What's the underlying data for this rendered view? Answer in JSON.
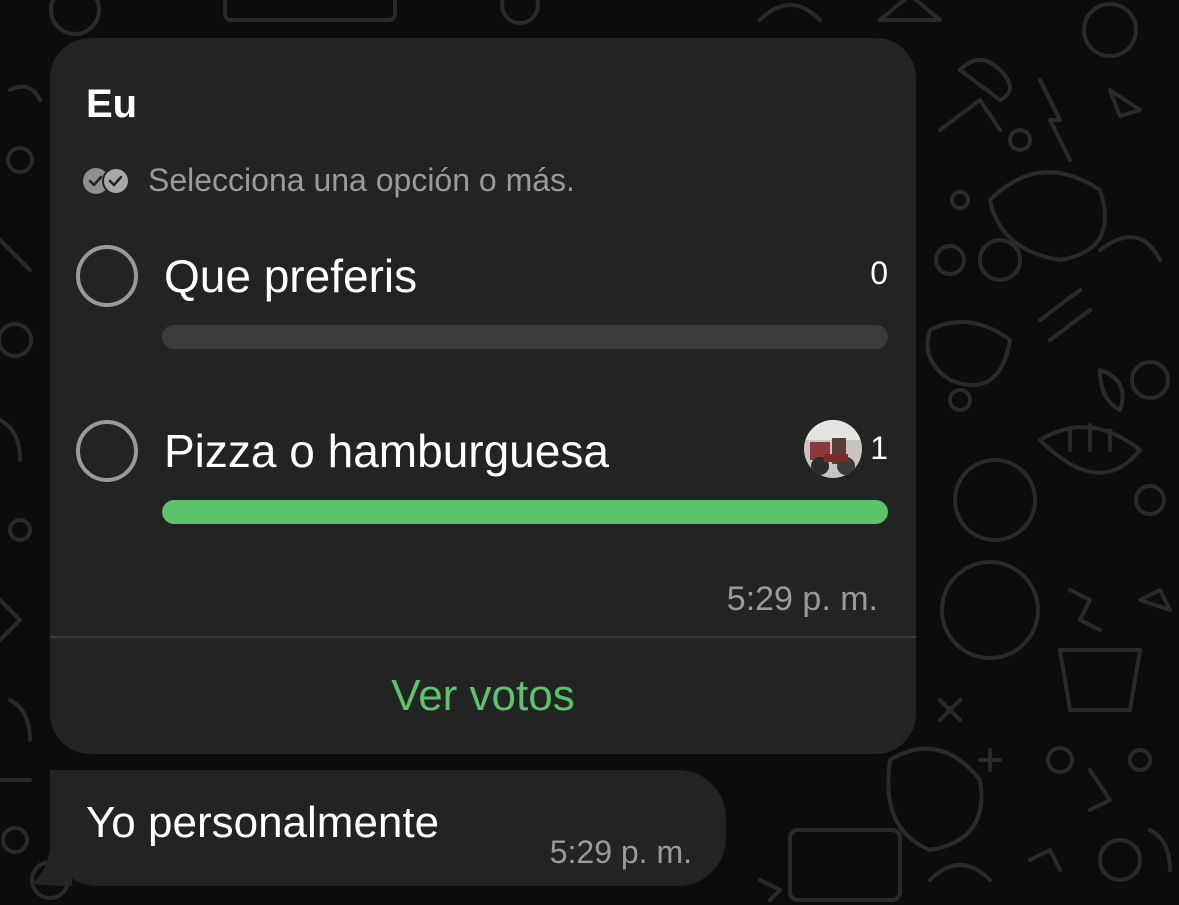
{
  "poll": {
    "sender": "Eu",
    "hint": "Selecciona una opción o más.",
    "options": [
      {
        "label": "Que preferis",
        "votes": "0",
        "fill_fraction": 0
      },
      {
        "label": "Pizza o hamburguesa",
        "votes": "1",
        "fill_fraction": 1
      }
    ],
    "time": "5:29 p. m.",
    "view_votes_label": "Ver votos"
  },
  "message": {
    "text": "Yo personalmente",
    "time": "5:29 p. m."
  },
  "colors": {
    "accent": "#5dc36b",
    "bubble": "#222323",
    "background": "#0c0c0c"
  }
}
